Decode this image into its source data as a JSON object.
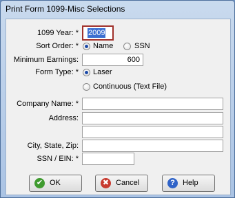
{
  "window": {
    "title": "Print Form 1099-Misc Selections"
  },
  "labels": {
    "year": "1099 Year: *",
    "sort_order": "Sort Order: *",
    "min_earnings": "Minimum Earnings:",
    "form_type": "Form Type: *",
    "company_name": "Company Name: *",
    "address": "Address:",
    "city_state_zip": "City, State, Zip:",
    "ssn_ein": "SSN / EIN: *"
  },
  "fields": {
    "year": "2009",
    "min_earnings": "600",
    "company_name": "",
    "address_line1": "",
    "address_line2": "",
    "city_state_zip": "",
    "ssn_ein": ""
  },
  "sort_order": {
    "options": [
      "Name",
      "SSN"
    ],
    "selected": "Name"
  },
  "form_type": {
    "options": [
      "Laser",
      "Continuous (Text File)"
    ],
    "selected": "Laser"
  },
  "buttons": {
    "ok": "OK",
    "cancel": "Cancel",
    "help": "Help"
  },
  "icons": {
    "ok": "check-icon",
    "cancel": "x-icon",
    "help": "question-icon"
  },
  "colors": {
    "ok_icon": "#3f9b2f",
    "cancel_icon": "#c83a2f",
    "help_icon": "#2f63c8",
    "focus_border": "#a0302a"
  }
}
